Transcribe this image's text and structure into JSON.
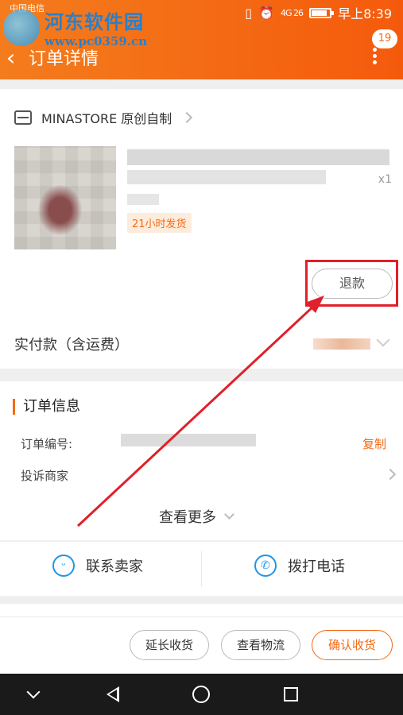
{
  "status_bar": {
    "carrier": "中国电信",
    "network": "4G 26",
    "time": "早上8:39"
  },
  "watermark": {
    "title": "河东软件园",
    "url": "www.pc0359.cn"
  },
  "header": {
    "back_icon": "chevron-left-icon",
    "title": "订单详情",
    "badge_count": "19",
    "more_icon": "more-vertical-icon"
  },
  "store": {
    "name": "MINASTORE 原创自制"
  },
  "product": {
    "quantity": "x1",
    "ship_tag": "21小时发货"
  },
  "actions": {
    "refund": "退款"
  },
  "payment": {
    "label": "实付款（含运费）"
  },
  "order_info": {
    "title": "订单信息",
    "order_no_label": "订单编号:",
    "copy": "复制",
    "complaint": "投诉商家",
    "see_more": "查看更多"
  },
  "contact": {
    "seller": "联系卖家",
    "phone": "拨打电话"
  },
  "bottom_actions": {
    "extend": "延长收货",
    "logistics": "查看物流",
    "confirm": "确认收货"
  },
  "colors": {
    "accent": "#f46a14",
    "annotation": "#e0202a",
    "icon_blue": "#2196e3"
  }
}
